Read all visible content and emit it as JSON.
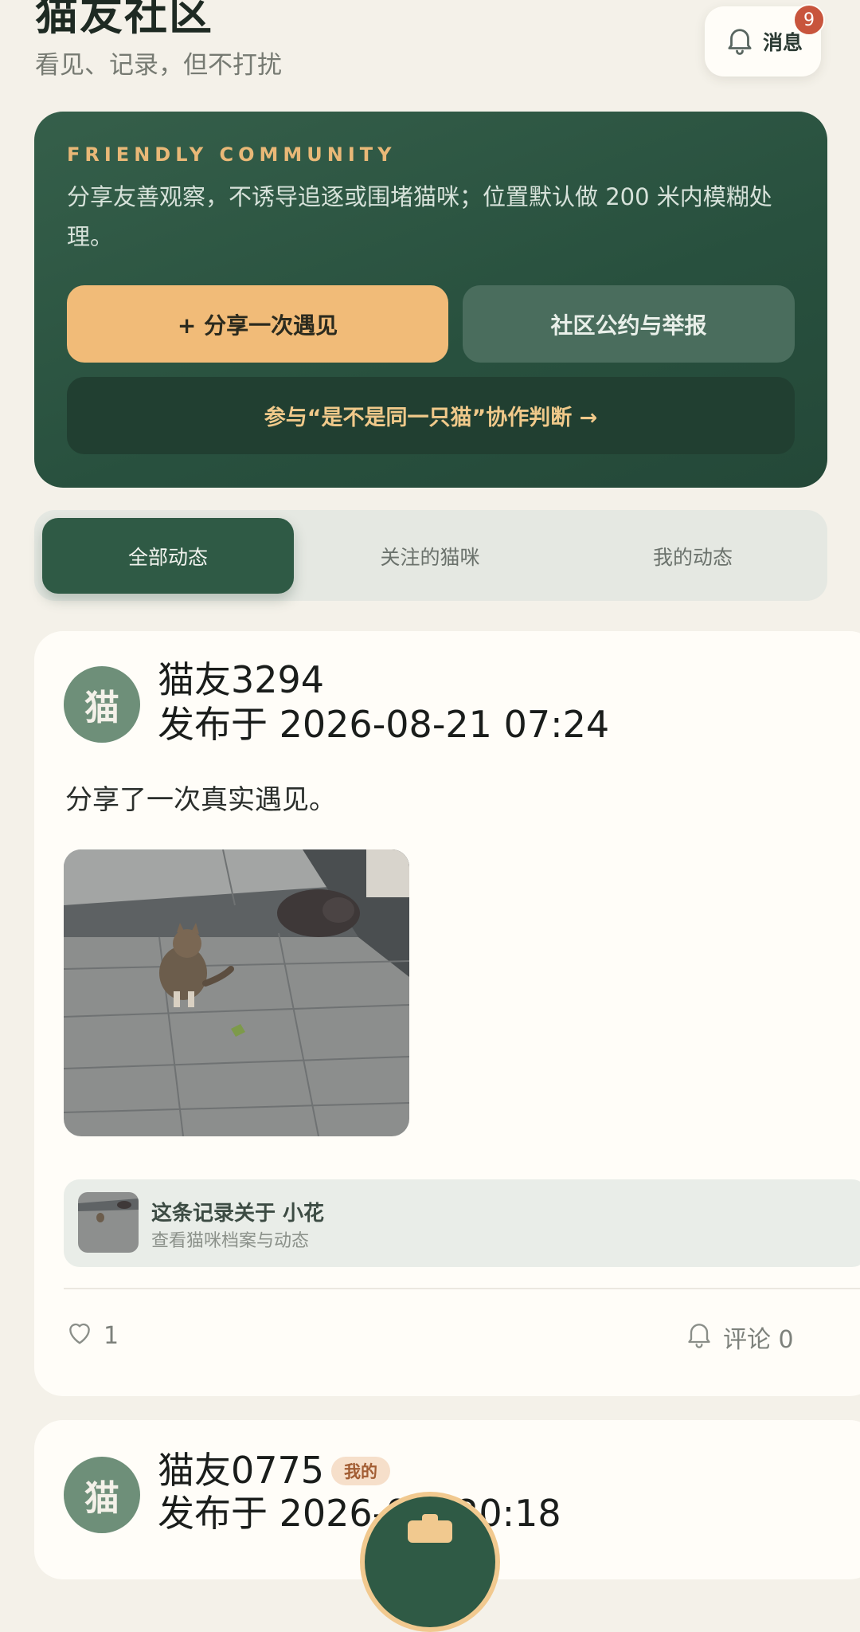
{
  "header": {
    "title": "猫友社区",
    "subtitle": "看见、记录，但不打扰",
    "messages_label": "消息",
    "messages_badge": "9"
  },
  "hero": {
    "kicker": "FRIENDLY COMMUNITY",
    "text": "分享友善观察，不诱导追逐或围堵猫咪；位置默认做 200 米内模糊处理。",
    "share_button": "+ 分享一次遇见",
    "rules_button": "社区公约与举报",
    "collab_button": "参与“是不是同一只猫”协作判断 →"
  },
  "tabs": [
    {
      "label": "全部动态",
      "active": true
    },
    {
      "label": "关注的猫咪",
      "active": false
    },
    {
      "label": "我的动态",
      "active": false
    }
  ],
  "posts": [
    {
      "avatar": "猫",
      "author": "猫友3294",
      "time": "发布于 2026-08-21 07:24",
      "body": "分享了一次真实遇见。",
      "cat_link_title": "这条记录关于 小花",
      "cat_link_sub": "查看猫咪档案与动态",
      "likes": "1",
      "comments": "评论 0"
    },
    {
      "avatar": "猫",
      "author": "猫友0775",
      "badge": "我的",
      "time": "发布于 2026-0 0 20:18"
    }
  ],
  "colors": {
    "accent_green": "#2f5a45",
    "accent_orange": "#f1bb78",
    "badge_red": "#c8553d",
    "background": "#f4f1e9"
  },
  "icons": [
    "bell-icon",
    "heart-icon",
    "comment-bell-icon",
    "camera-icon"
  ]
}
